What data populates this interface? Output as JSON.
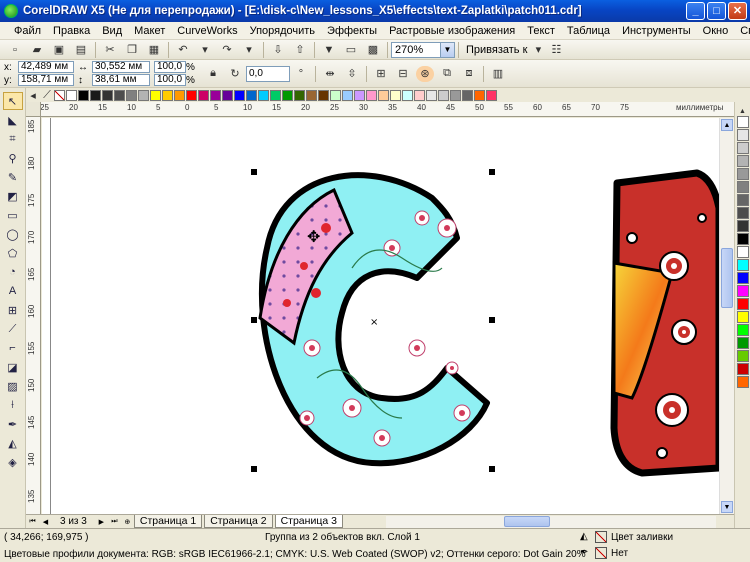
{
  "window": {
    "title": "CorelDRAW X5 (Не для перепродажи) - [E:\\disk-c\\New_lessons_X5\\effects\\text-Zaplatki\\patch011.cdr]",
    "controls": [
      "_",
      "□",
      "✕"
    ]
  },
  "menu": [
    "Файл",
    "Правка",
    "Вид",
    "Макет",
    "CurveWorks",
    "Упорядочить",
    "Эффекты",
    "Растровые изображения",
    "Текст",
    "Таблица",
    "Инструменты",
    "Окно",
    "Справка"
  ],
  "toolbar": {
    "zoom": "270%",
    "snap_label": "Привязать к"
  },
  "properties": {
    "x": "42,489 мм",
    "y": "158,71 мм",
    "width": "30,552 мм",
    "height": "38,61 мм",
    "scale_x": "100,0",
    "scale_y": "100,0",
    "percent": "%",
    "angle": "0,0",
    "x_label": "x:",
    "y_label": "y:"
  },
  "rulers": {
    "unit": "миллиметры",
    "top_ticks": [
      "25",
      "20",
      "15",
      "10",
      "5",
      "0",
      "5",
      "10",
      "15",
      "20",
      "25",
      "30",
      "35",
      "40",
      "45",
      "50",
      "55",
      "60",
      "65",
      "70",
      "75"
    ],
    "left_ticks": [
      "185",
      "180",
      "175",
      "170",
      "165",
      "160",
      "155",
      "150",
      "145",
      "140",
      "135"
    ]
  },
  "palette_top_colors": [
    "#ffffff",
    "#000000",
    "#1a1a1a",
    "#333333",
    "#4d4d4d",
    "#808080",
    "#b3b3b3",
    "#ffff00",
    "#ffcc00",
    "#ff9900",
    "#ff0000",
    "#cc0066",
    "#990099",
    "#660099",
    "#0000ff",
    "#0066cc",
    "#00ccff",
    "#00cc66",
    "#009900",
    "#336600",
    "#996633",
    "#663300",
    "#ccffcc",
    "#99ccff",
    "#cc99ff",
    "#ff99cc",
    "#ffcc99",
    "#ffffcc",
    "#ccffff",
    "#ffcccc",
    "#e6e6e6",
    "#cccccc",
    "#999999",
    "#666666",
    "#ff6600",
    "#ff3366"
  ],
  "palette_right_colors": [
    "#ffffff",
    "#e6e6e6",
    "#cccccc",
    "#b3b3b3",
    "#999999",
    "#808080",
    "#666666",
    "#4d4d4d",
    "#333333",
    "#000000",
    "#ffffff",
    "#00ffff",
    "#0000ff",
    "#ff00ff",
    "#ff0000",
    "#ffff00",
    "#00ff00",
    "#009900",
    "#66cc00",
    "#cc0000",
    "#ff6600"
  ],
  "pages": {
    "count": "3 из 3",
    "tabs": [
      "Страница 1",
      "Страница 2",
      "Страница 3"
    ],
    "active": 2
  },
  "status": {
    "coords": "( 34,266; 169,975 )",
    "info": "Группа из 2 объектов вкл. Слой 1",
    "profiles": "Цветовые профили документа: RGB: sRGB IEC61966-2.1; CMYK: U.S. Web Coated (SWOP) v2; Оттенки серого: Dot Gain 20%",
    "fill": "Цвет заливки",
    "outline": "Нет"
  }
}
